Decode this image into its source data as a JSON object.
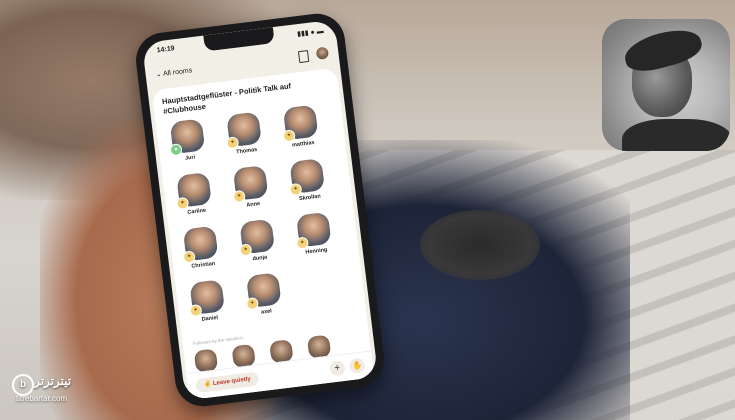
{
  "phone": {
    "status_time": "14:19",
    "status_icons": "▮▮▮ ● ▬",
    "back_label": "All rooms",
    "room_title": "Hauptstadtgeflüster - Politik Talk auf #Clubhouse",
    "speakers": [
      {
        "name": "Juri"
      },
      {
        "name": "Thomas"
      },
      {
        "name": "matthias"
      },
      {
        "name": "Carline"
      },
      {
        "name": "Anne"
      },
      {
        "name": "Skrollan"
      },
      {
        "name": "Christian"
      },
      {
        "name": "dunja"
      },
      {
        "name": "Henning"
      },
      {
        "name": "Daniel"
      },
      {
        "name": "axel"
      }
    ],
    "followed_label": "Followed by the speakers",
    "leave_label": "Leave quietly",
    "plus_label": "+",
    "raise_icon": "hand-icon"
  },
  "watermark": {
    "logo": "b",
    "text": "تیترترتر",
    "url": "titrebartar.com"
  }
}
